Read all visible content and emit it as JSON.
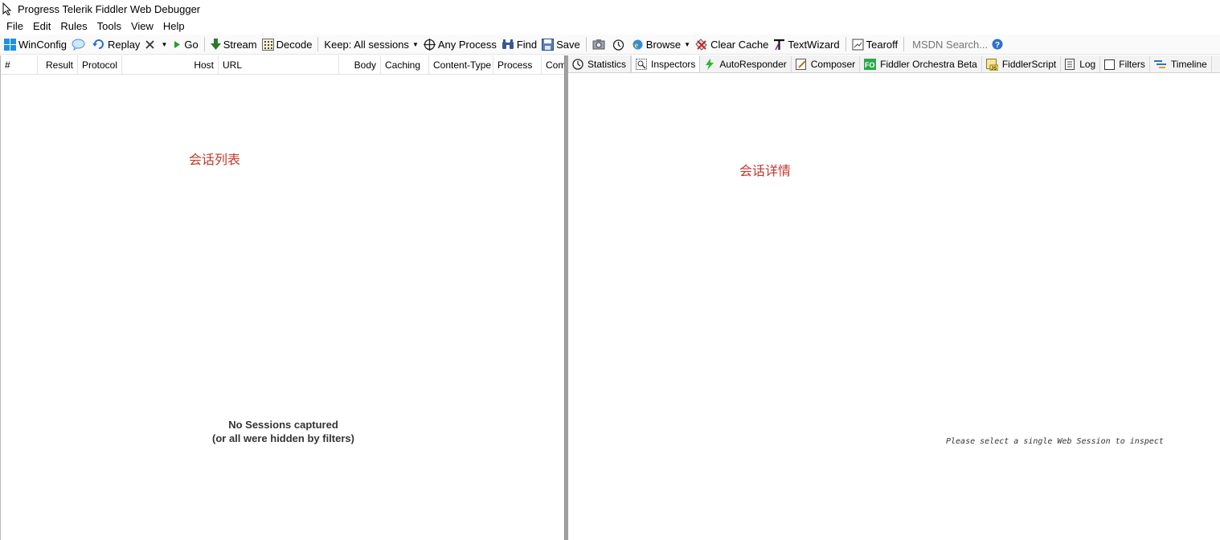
{
  "window": {
    "title": "Progress Telerik Fiddler Web Debugger"
  },
  "menu": [
    "File",
    "Edit",
    "Rules",
    "Tools",
    "View",
    "Help"
  ],
  "toolbar": {
    "winconfig": "WinConfig",
    "replay": "Replay",
    "go": "Go",
    "stream": "Stream",
    "decode": "Decode",
    "keep": "Keep: All sessions",
    "any_process": "Any Process",
    "find": "Find",
    "save": "Save",
    "browse": "Browse",
    "clear_cache": "Clear Cache",
    "textwizard": "TextWizard",
    "tearoff": "Tearoff",
    "msdn_placeholder": "MSDN Search..."
  },
  "sessions": {
    "columns": [
      "#",
      "Result",
      "Protocol",
      "Host",
      "URL",
      "Body",
      "Caching",
      "Content-Type",
      "Process",
      "Comm"
    ],
    "empty_line1": "No Sessions captured",
    "empty_line2": "(or all were hidden by filters)",
    "annotation": "会话列表"
  },
  "detail": {
    "tabs": [
      "Statistics",
      "Inspectors",
      "AutoResponder",
      "Composer",
      "Fiddler Orchestra Beta",
      "FiddlerScript",
      "Log",
      "Filters",
      "Timeline"
    ],
    "active_tab": "Inspectors",
    "inspect_message": "Please select a single Web Session to inspect",
    "annotation": "会话详情"
  }
}
